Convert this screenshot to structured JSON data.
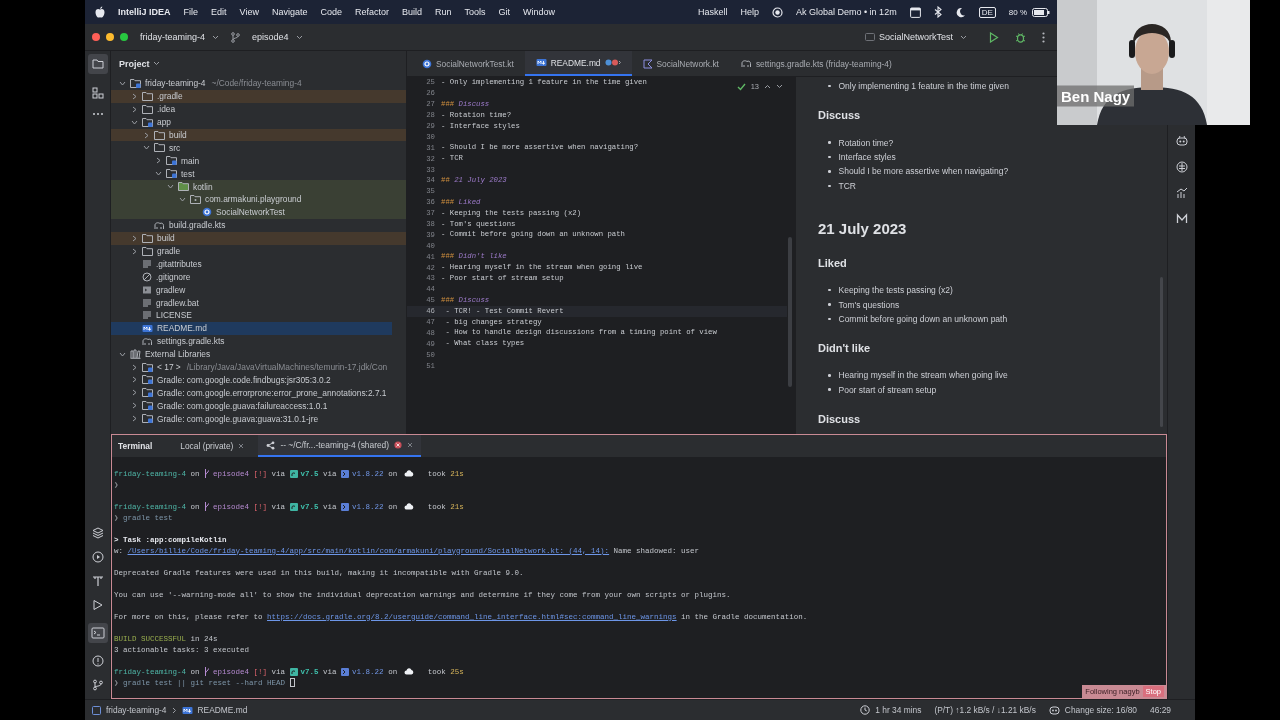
{
  "menubar": {
    "app": "IntelliJ IDEA",
    "menus": [
      "File",
      "Edit",
      "View",
      "Navigate",
      "Code",
      "Refactor",
      "Build",
      "Run",
      "Tools",
      "Git",
      "Window"
    ],
    "extras": [
      "Haskell",
      "Help"
    ],
    "event": "Ak Global Demo • in 12m",
    "input_source": "DE",
    "battery": "80 %"
  },
  "toolbar": {
    "project": "friday-teaming-4",
    "branch": "episode4",
    "run_config": "SocialNetworkTest"
  },
  "project_panel": {
    "title": "Project",
    "tree": [
      {
        "label": "friday-teaming-4",
        "hint": "~/Code/friday-teaming-4",
        "kind": "module",
        "expanded": true,
        "selected": false,
        "children": [
          {
            "label": ".gradle",
            "kind": "folder",
            "expanded": false,
            "selected": false,
            "color": "#45392d"
          },
          {
            "label": ".idea",
            "kind": "folder",
            "expanded": false,
            "selected": false
          },
          {
            "label": "app",
            "kind": "module",
            "expanded": true,
            "selected": false,
            "children": [
              {
                "label": "build",
                "kind": "folder",
                "expanded": false,
                "selected": false,
                "color": "#45392d"
              },
              {
                "label": "src",
                "kind": "folder",
                "expanded": true,
                "selected": false,
                "children": [
                  {
                    "label": "main",
                    "kind": "source-root",
                    "expanded": false,
                    "selected": false
                  },
                  {
                    "label": "test",
                    "kind": "source-root",
                    "expanded": true,
                    "selected": false,
                    "children": [
                      {
                        "label": "kotlin",
                        "kind": "test-root",
                        "expanded": true,
                        "selected": false,
                        "color": "#3a4034",
                        "children": [
                          {
                            "label": "com.armakuni.playground",
                            "kind": "package",
                            "expanded": true,
                            "selected": false,
                            "color": "#3a4034",
                            "children": [
                              {
                                "label": "SocialNetworkTest",
                                "kind": "class",
                                "selected": false,
                                "color": "#3a4034"
                              }
                            ]
                          }
                        ]
                      }
                    ]
                  }
                ]
              },
              {
                "label": "build.gradle.kts",
                "kind": "gradle",
                "selected": false
              }
            ]
          },
          {
            "label": "build",
            "kind": "folder",
            "expanded": false,
            "selected": false,
            "color": "#45392d"
          },
          {
            "label": "gradle",
            "kind": "folder",
            "expanded": false,
            "selected": false
          },
          {
            "label": ".gitattributes",
            "kind": "text",
            "selected": false
          },
          {
            "label": ".gitignore",
            "kind": "ignore",
            "selected": false
          },
          {
            "label": "gradlew",
            "kind": "script",
            "selected": false
          },
          {
            "label": "gradlew.bat",
            "kind": "text",
            "selected": false
          },
          {
            "label": "LICENSE",
            "kind": "text",
            "selected": false
          },
          {
            "label": "README.md",
            "kind": "markdown",
            "selected": true
          },
          {
            "label": "settings.gradle.kts",
            "kind": "gradle",
            "selected": false
          }
        ]
      },
      {
        "label": "External Libraries",
        "kind": "library",
        "expanded": true,
        "selected": false,
        "children": [
          {
            "label": "< 17 >",
            "hint": "/Library/Java/JavaVirtualMachines/temurin-17.jdk/Con",
            "kind": "sdk",
            "expanded": false,
            "selected": false
          },
          {
            "label": "Gradle: com.google.code.findbugs:jsr305:3.0.2",
            "kind": "sdk",
            "expanded": false,
            "selected": false
          },
          {
            "label": "Gradle: com.google.errorprone:error_prone_annotations:2.7.1",
            "kind": "sdk",
            "expanded": false,
            "selected": false
          },
          {
            "label": "Gradle: com.google.guava:failureaccess:1.0.1",
            "kind": "sdk",
            "expanded": false,
            "selected": false
          },
          {
            "label": "Gradle: com.google.guava:guava:31.0.1-jre",
            "kind": "sdk",
            "expanded": false,
            "selected": false
          }
        ]
      }
    ]
  },
  "editor_tabs": [
    {
      "label": "SocialNetworkTest.kt",
      "kind": "test-class",
      "selected": false
    },
    {
      "label": "README.md",
      "kind": "markdown",
      "selected": true
    },
    {
      "label": "SocialNetwork.kt",
      "kind": "kotlin",
      "selected": false
    },
    {
      "label": "settings.gradle.kts (friday-teaming-4)",
      "kind": "gradle",
      "selected": false
    }
  ],
  "editor": {
    "inspection_count": "13",
    "lines": [
      {
        "number": "25",
        "kind": "text",
        "text": "- Only implementing 1 feature in the time given",
        "current": false
      },
      {
        "number": "26",
        "kind": "blank",
        "current": false
      },
      {
        "number": "27",
        "kind": "heading",
        "marker": "###",
        "text": "Discuss",
        "current": false
      },
      {
        "number": "28",
        "kind": "text",
        "text": "- Rotation time?",
        "current": false
      },
      {
        "number": "29",
        "kind": "text",
        "text": "- Interface styles",
        "current": false
      },
      {
        "number": "30",
        "kind": "blank",
        "current": false
      },
      {
        "number": "31",
        "kind": "text",
        "text": "- Should I be more assertive when navigating?",
        "current": false
      },
      {
        "number": "32",
        "kind": "text",
        "text": "- TCR",
        "current": false
      },
      {
        "number": "33",
        "kind": "blank",
        "current": false
      },
      {
        "number": "34",
        "kind": "heading",
        "marker": "##",
        "text": "21 July 2023",
        "current": false
      },
      {
        "number": "35",
        "kind": "blank",
        "current": false
      },
      {
        "number": "36",
        "kind": "heading",
        "marker": "###",
        "text": "Liked",
        "current": false
      },
      {
        "number": "37",
        "kind": "text",
        "text": "- Keeping the tests passing (x2)",
        "current": false
      },
      {
        "number": "38",
        "kind": "text",
        "text": "- Tom's questions",
        "current": false
      },
      {
        "number": "39",
        "kind": "text",
        "text": "- Commit before going down an unknown path",
        "current": false
      },
      {
        "number": "40",
        "kind": "blank",
        "current": false
      },
      {
        "number": "41",
        "kind": "heading",
        "marker": "###",
        "text": "Didn't like",
        "current": false
      },
      {
        "number": "42",
        "kind": "text",
        "text": "- Hearing myself in the stream when going live",
        "current": false
      },
      {
        "number": "43",
        "kind": "text",
        "text": "- Poor start of stream setup",
        "current": false
      },
      {
        "number": "44",
        "kind": "blank",
        "current": false
      },
      {
        "number": "45",
        "kind": "heading",
        "marker": "###",
        "text": "Discuss",
        "current": false
      },
      {
        "number": "46",
        "kind": "text",
        "text": " - TCR! - Test Commit Revert",
        "current": true
      },
      {
        "number": "47",
        "kind": "text",
        "text": " - big changes strategy",
        "current": false
      },
      {
        "number": "48",
        "kind": "text",
        "text": " - How to handle design discussions from a timing point of view",
        "current": false
      },
      {
        "number": "49",
        "kind": "text",
        "text": " - What class types",
        "current": false
      },
      {
        "number": "50",
        "kind": "blank",
        "current": false
      },
      {
        "number": "51",
        "kind": "blank",
        "current": false
      }
    ]
  },
  "preview": {
    "blocks": [
      {
        "kind": "bullet",
        "text": "Only implementing 1 feature in the time given"
      },
      {
        "kind": "h3",
        "text": "Discuss"
      },
      {
        "kind": "bullet",
        "text": "Rotation time?"
      },
      {
        "kind": "bullet",
        "text": "Interface styles"
      },
      {
        "kind": "bullet",
        "text": "Should I be more assertive when navigating?"
      },
      {
        "kind": "bullet",
        "text": "TCR"
      },
      {
        "kind": "h2",
        "text": "21 July 2023"
      },
      {
        "kind": "h3",
        "text": "Liked"
      },
      {
        "kind": "bullet",
        "text": "Keeping the tests passing (x2)"
      },
      {
        "kind": "bullet",
        "text": "Tom's questions"
      },
      {
        "kind": "bullet",
        "text": "Commit before going down an unknown path"
      },
      {
        "kind": "h3",
        "text": "Didn't like"
      },
      {
        "kind": "bullet",
        "text": "Hearing myself in the stream when going live"
      },
      {
        "kind": "bullet",
        "text": "Poor start of stream setup"
      },
      {
        "kind": "h3",
        "text": "Discuss"
      }
    ]
  },
  "terminal": {
    "title": "Terminal",
    "tabs": [
      {
        "label": "Local (private)",
        "shared": false,
        "selected": false
      },
      {
        "label": "-- ~/C/fr...-teaming-4 (shared)",
        "shared": true,
        "selected": true
      }
    ],
    "lines": [
      {
        "kind": "text",
        "segments": [
          {
            "kind": "dir",
            "text": "friday-teaming-4"
          },
          {
            "kind": "plain",
            "text": "on"
          },
          {
            "kind": "branch",
            "text": "episode4"
          },
          {
            "kind": "status",
            "text": "[!]"
          },
          {
            "kind": "plain",
            "text": "via"
          },
          {
            "kind": "gradle",
            "text": "v7.5"
          },
          {
            "kind": "plain",
            "text": "via"
          },
          {
            "kind": "kotlin",
            "text": "v1.8.22"
          },
          {
            "kind": "plain",
            "text": "on"
          },
          {
            "kind": "cloud"
          },
          {
            "kind": "plain",
            "text": "took"
          },
          {
            "kind": "took",
            "text": "21s"
          }
        ]
      },
      {
        "kind": "text",
        "segments": [
          {
            "kind": "prompt",
            "text": "❯"
          }
        ]
      },
      {
        "kind": "blank"
      },
      {
        "kind": "text",
        "segments": [
          {
            "kind": "dir",
            "text": "friday-teaming-4"
          },
          {
            "kind": "plain",
            "text": "on"
          },
          {
            "kind": "branch",
            "text": "episode4"
          },
          {
            "kind": "status",
            "text": "[!]"
          },
          {
            "kind": "plain",
            "text": "via"
          },
          {
            "kind": "gradle",
            "text": "v7.5"
          },
          {
            "kind": "plain",
            "text": "via"
          },
          {
            "kind": "kotlin",
            "text": "v1.8.22"
          },
          {
            "kind": "plain",
            "text": "on"
          },
          {
            "kind": "cloud"
          },
          {
            "kind": "plain",
            "text": "took"
          },
          {
            "kind": "took",
            "text": "21s"
          }
        ]
      },
      {
        "kind": "text",
        "segments": [
          {
            "kind": "prompt",
            "text": "❯"
          },
          {
            "kind": "cmd",
            "text": "gradle test"
          }
        ]
      },
      {
        "kind": "blank"
      },
      {
        "kind": "text",
        "segments": [
          {
            "kind": "bold",
            "text": "> Task :app:compileKotlin"
          }
        ]
      },
      {
        "kind": "text",
        "segments": [
          {
            "kind": "plain",
            "text": "w:"
          },
          {
            "kind": "link",
            "text": "/Users/billie/Code/friday-teaming-4/app/src/main/kotlin/com/armakuni/playground/SocialNetwork.kt: (44, 14):"
          },
          {
            "kind": "plain",
            "text": "Name shadowed: user"
          }
        ]
      },
      {
        "kind": "blank"
      },
      {
        "kind": "text",
        "segments": [
          {
            "kind": "plain",
            "text": "Deprecated Gradle features were used in this build, making it incompatible with Gradle 9.0."
          }
        ]
      },
      {
        "kind": "blank"
      },
      {
        "kind": "text",
        "segments": [
          {
            "kind": "plain",
            "text": "You can use '--warning-mode all' to show the individual deprecation warnings and determine if they come from your own scripts or plugins."
          }
        ]
      },
      {
        "kind": "blank"
      },
      {
        "kind": "text",
        "segments": [
          {
            "kind": "plain",
            "text": "For more on this, please refer to"
          },
          {
            "kind": "link",
            "text": "https://docs.gradle.org/8.2/userguide/command_line_interface.html#sec:command_line_warnings"
          },
          {
            "kind": "plain",
            "text": "in the Gradle documentation."
          }
        ]
      },
      {
        "kind": "blank"
      },
      {
        "kind": "text",
        "segments": [
          {
            "kind": "success",
            "text": "BUILD SUCCESSFUL"
          },
          {
            "kind": "plain",
            "text": "in 24s"
          }
        ]
      },
      {
        "kind": "text",
        "segments": [
          {
            "kind": "plain",
            "text": "3 actionable tasks: 3 executed"
          }
        ]
      },
      {
        "kind": "blank"
      },
      {
        "kind": "text",
        "segments": [
          {
            "kind": "dir",
            "text": "friday-teaming-4"
          },
          {
            "kind": "plain",
            "text": "on"
          },
          {
            "kind": "branch",
            "text": "episode4"
          },
          {
            "kind": "status",
            "text": "[!]"
          },
          {
            "kind": "plain",
            "text": "via"
          },
          {
            "kind": "gradle",
            "text": "v7.5"
          },
          {
            "kind": "plain",
            "text": "via"
          },
          {
            "kind": "kotlin",
            "text": "v1.8.22"
          },
          {
            "kind": "plain",
            "text": "on"
          },
          {
            "kind": "cloud"
          },
          {
            "kind": "plain",
            "text": "took"
          },
          {
            "kind": "took",
            "text": "25s"
          }
        ]
      },
      {
        "kind": "text",
        "segments": [
          {
            "kind": "prompt",
            "text": "❯"
          },
          {
            "kind": "cmd",
            "text": "gradle test || git reset --hard HEAD"
          },
          {
            "kind": "cursor"
          }
        ]
      }
    ]
  },
  "follow_badge": {
    "text": "Following nagyb",
    "action": "Stop"
  },
  "status_bar": {
    "breadcrumbs": [
      "friday-teaming-4",
      "README.md"
    ],
    "timer": "1 hr 34 mins",
    "network": "(P/T) ↑1.2 kB/s / ↓1.21 kB/s",
    "change_size": "Change size: 16/80",
    "time": "46:29"
  },
  "video": {
    "name": "Ben Nagy"
  }
}
